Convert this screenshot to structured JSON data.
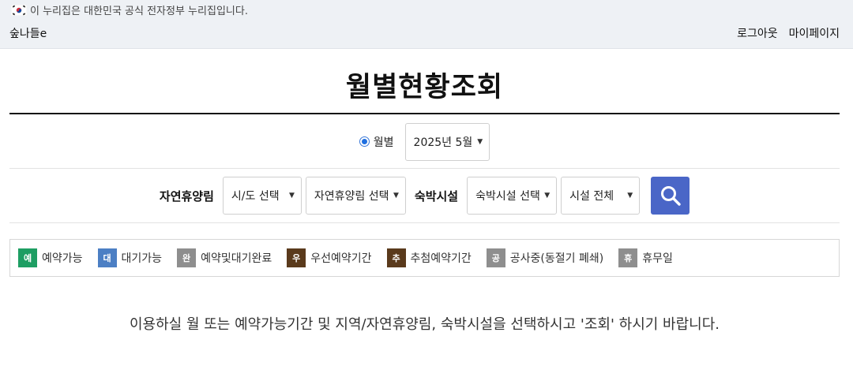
{
  "header": {
    "gov_notice": "이 누리집은 대한민국 공식 전자정부 누리집입니다.",
    "site_name": "숲나들e",
    "links": {
      "logout": "로그아웃",
      "mypage": "마이페이지"
    }
  },
  "page": {
    "title": "월별현황조회"
  },
  "month_selector": {
    "radio_label": "월별",
    "radio_checked": true,
    "selected_month": "2025년 5월"
  },
  "filters": {
    "forest_label": "자연휴양림",
    "region_select": "시/도 선택",
    "forest_select": "자연휴양림 선택",
    "lodging_label": "숙박시설",
    "lodging_select": "숙박시설 선택",
    "facility_select": "시설 전체",
    "search_icon": "search-icon"
  },
  "legend": [
    {
      "badge": "예",
      "label": "예약가능",
      "color": "#1e9e63"
    },
    {
      "badge": "대",
      "label": "대기가능",
      "color": "#4c7fc4"
    },
    {
      "badge": "완",
      "label": "예약및대기완료",
      "color": "#8e8e8e"
    },
    {
      "badge": "우",
      "label": "우선예약기간",
      "color": "#5a3a1c"
    },
    {
      "badge": "추",
      "label": "추첨예약기간",
      "color": "#5a3a1c"
    },
    {
      "badge": "공",
      "label": "공사중(동절기 폐쇄)",
      "color": "#8e8e8e"
    },
    {
      "badge": "휴",
      "label": "휴무일",
      "color": "#8e8e8e"
    }
  ],
  "message": "이용하실 월 또는 예약가능기간 및 지역/자연휴양림, 숙박시설을 선택하시고 '조회' 하시기 바랍니다.",
  "colors": {
    "search_button": "#4a66c7",
    "topbar": "#eef1f5"
  }
}
